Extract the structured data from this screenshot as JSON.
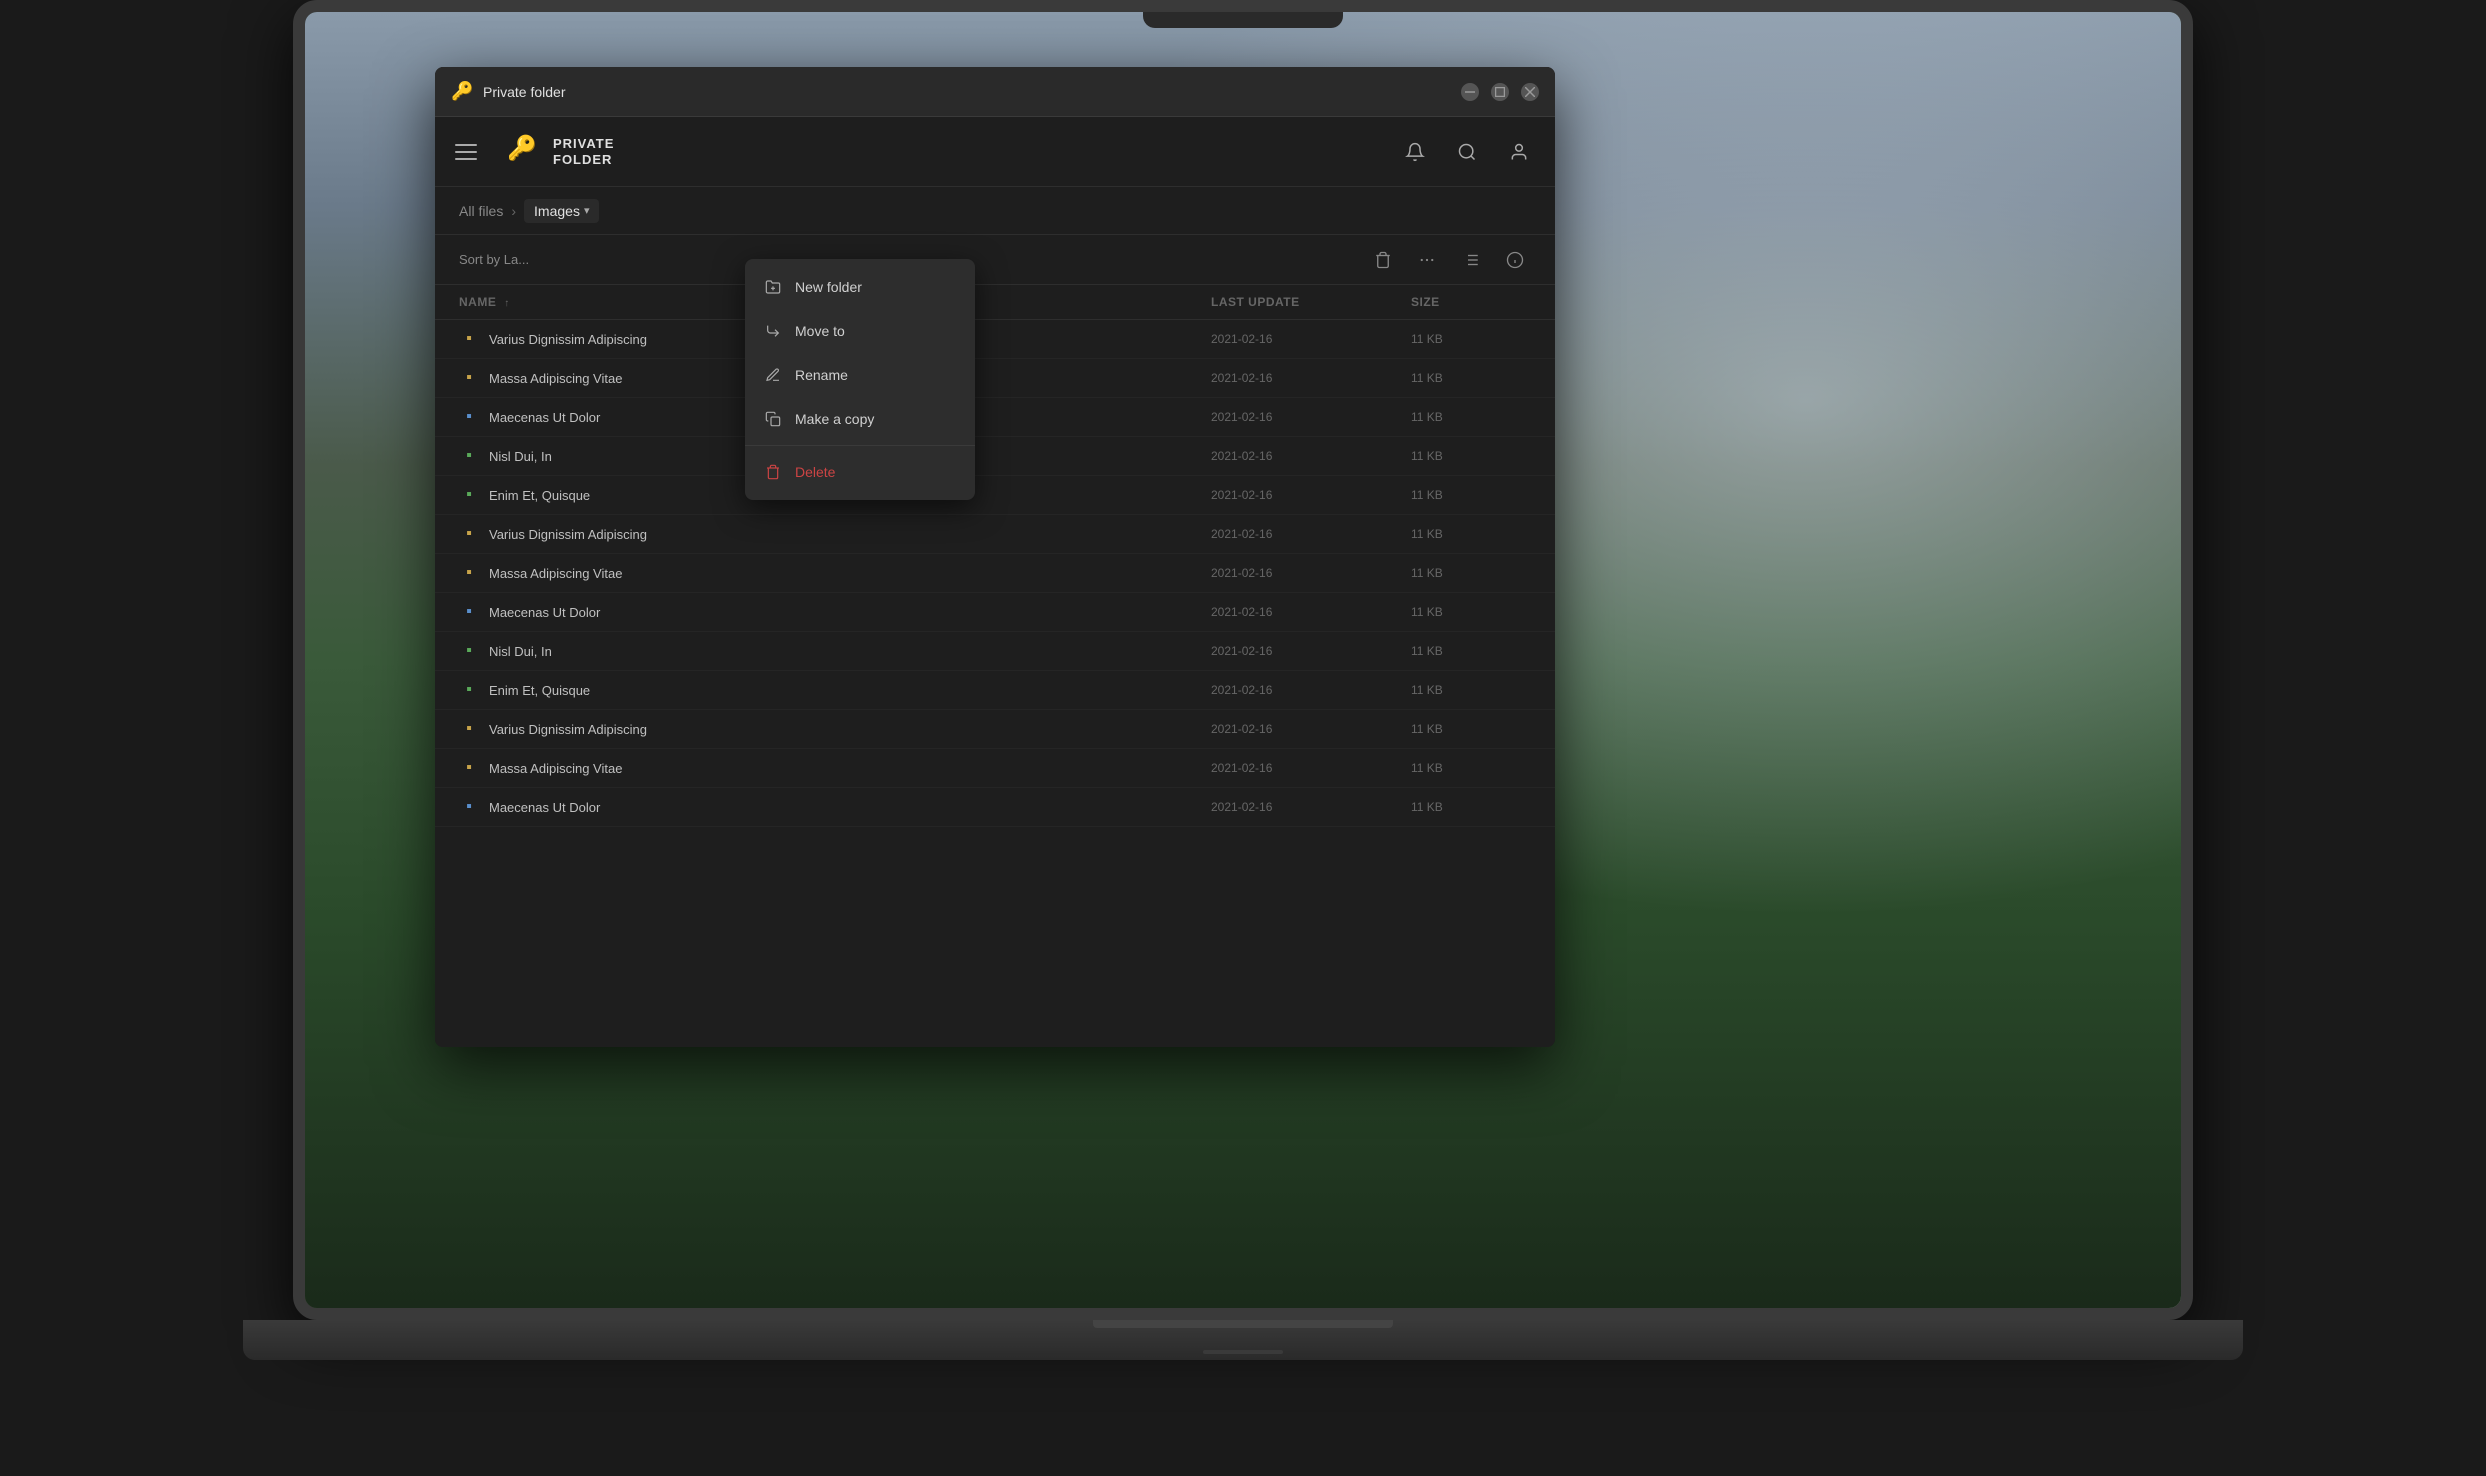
{
  "titleBar": {
    "title": "Private folder",
    "icon": "🔑",
    "minimizeLabel": "–",
    "maximizeLabel": "□",
    "closeLabel": "✕"
  },
  "header": {
    "brandName1": "PRIVATE",
    "brandName2": "FOLDER",
    "hamburgerLabel": "Menu",
    "bellLabel": "Notifications",
    "searchLabel": "Search",
    "profileLabel": "Profile"
  },
  "breadcrumb": {
    "allFiles": "All files",
    "separator": "›",
    "current": "Images",
    "chevron": "▾"
  },
  "toolbar": {
    "sortLabel": "Sort by La...",
    "deleteIcon": "🗑",
    "moreIcon": "⋯",
    "listIcon": "☰",
    "infoIcon": "ⓘ"
  },
  "fileList": {
    "columns": {
      "name": "Name",
      "nameSort": "↑",
      "lastUpdate": "Last Update",
      "size": "Size"
    },
    "files": [
      {
        "name": "Varius Dignissim Adipiscing",
        "type": "folder",
        "date": "2021-02-16",
        "size": "11 KB"
      },
      {
        "name": "Massa Adipiscing Vitae",
        "type": "folder",
        "date": "2021-02-16",
        "size": "11 KB"
      },
      {
        "name": "Maecenas Ut Dolor",
        "type": "doc",
        "date": "2021-02-16",
        "size": "11 KB"
      },
      {
        "name": "Nisl Dui, In",
        "type": "doc-green",
        "date": "2021-02-16",
        "size": "11 KB"
      },
      {
        "name": "Enim Et, Quisque",
        "type": "doc-green",
        "date": "2021-02-16",
        "size": "11 KB"
      },
      {
        "name": "Varius Dignissim Adipiscing",
        "type": "folder",
        "date": "2021-02-16",
        "size": "11 KB"
      },
      {
        "name": "Massa Adipiscing Vitae",
        "type": "folder",
        "date": "2021-02-16",
        "size": "11 KB"
      },
      {
        "name": "Maecenas Ut Dolor",
        "type": "doc",
        "date": "2021-02-16",
        "size": "11 KB"
      },
      {
        "name": "Nisl Dui, In",
        "type": "doc-green",
        "date": "2021-02-16",
        "size": "11 KB"
      },
      {
        "name": "Enim Et, Quisque",
        "type": "doc-green",
        "date": "2021-02-16",
        "size": "11 KB"
      },
      {
        "name": "Varius Dignissim Adipiscing",
        "type": "folder",
        "date": "2021-02-16",
        "size": "11 KB"
      },
      {
        "name": "Massa Adipiscing Vitae",
        "type": "folder",
        "date": "2021-02-16",
        "size": "11 KB"
      },
      {
        "name": "Maecenas Ut Dolor",
        "type": "doc",
        "date": "2021-02-16",
        "size": "11 KB"
      }
    ]
  },
  "contextMenu": {
    "items": [
      {
        "id": "new-folder",
        "label": "New folder",
        "icon": "new-folder-icon"
      },
      {
        "id": "move-to",
        "label": "Move to",
        "icon": "move-to-icon"
      },
      {
        "id": "rename",
        "label": "Rename",
        "icon": "rename-icon"
      },
      {
        "id": "make-copy",
        "label": "Make a copy",
        "icon": "copy-icon"
      },
      {
        "id": "delete",
        "label": "Delete",
        "icon": "trash-icon",
        "danger": true
      }
    ]
  }
}
